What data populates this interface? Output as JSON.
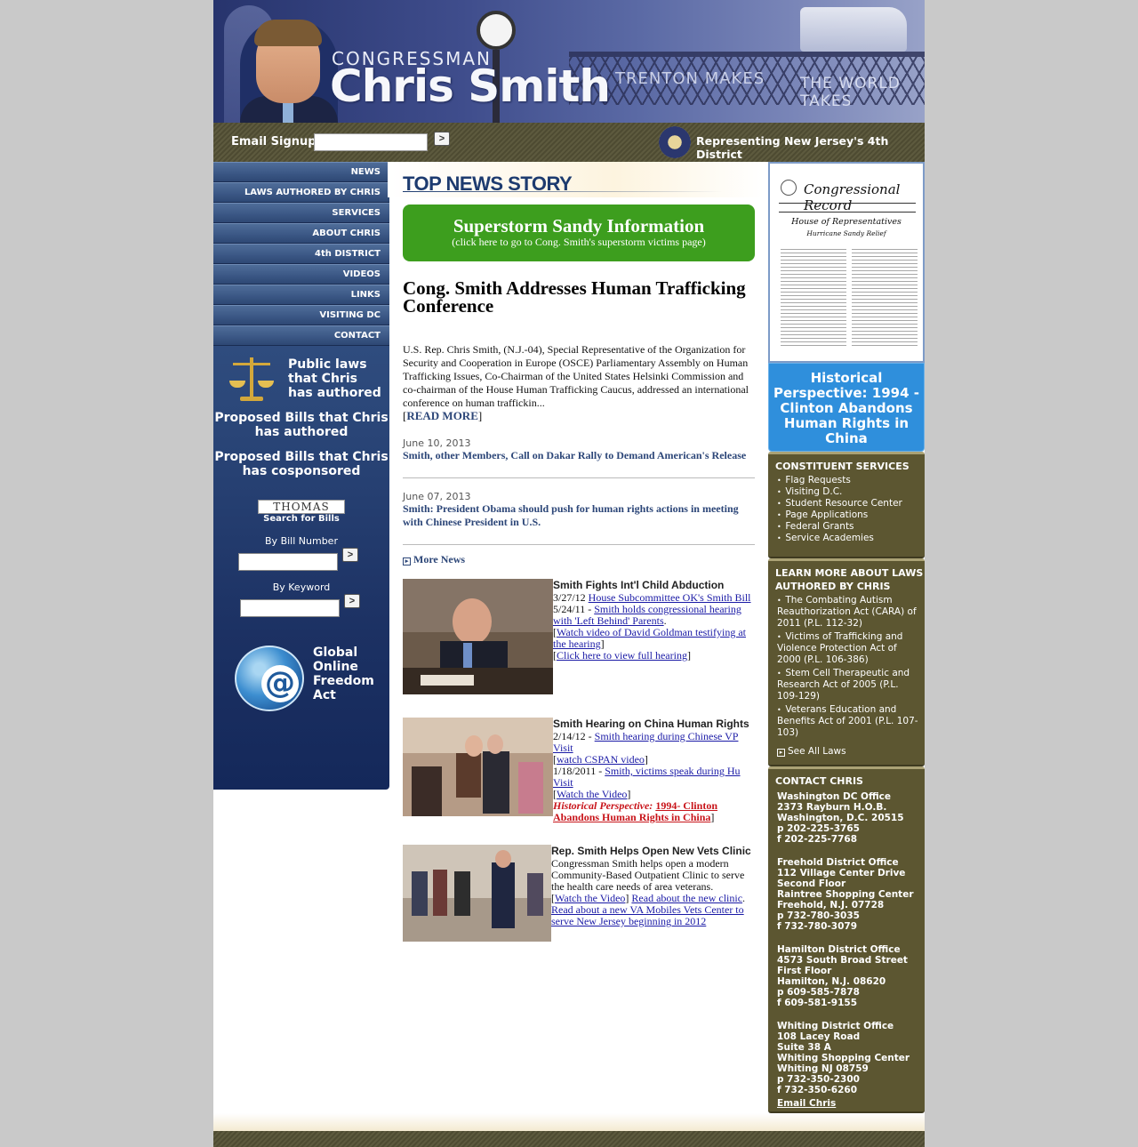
{
  "banner": {
    "congressman": "CONGRESSMAN",
    "name": "Chris Smith",
    "trenton": "TRENTON   MAKES",
    "world": "THE WORLD TAKES"
  },
  "signup": {
    "label": "Email Signup",
    "input_value": "",
    "go_label": ">",
    "representing": "Representing New Jersey's 4th District"
  },
  "nav": [
    "NEWS",
    "LAWS AUTHORED BY CHRIS",
    "SERVICES",
    "ABOUT CHRIS",
    "4th DISTRICT",
    "VIDEOS",
    "LINKS",
    "VISITING DC",
    "CONTACT"
  ],
  "left": {
    "public_laws": "Public laws that Chris has authored",
    "proposed_authored": "Proposed Bills that Chris has authored",
    "proposed_cosponsored": "Proposed Bills that Chris has cosponsored",
    "thomas": "THOMAS",
    "thomas_sub": "Search for Bills",
    "bill_number_label": "By Bill Number",
    "keyword_label": "By Keyword",
    "go_label": ">",
    "gofa": "Global Online Freedom Act"
  },
  "center": {
    "top_news": "TOP NEWS STORY",
    "sandy_title": "Superstorm Sandy Information",
    "sandy_sub": "(click here to go to Cong. Smith's superstorm victims page)",
    "headline": "Cong. Smith Addresses Human Trafficking Conference",
    "body": "U.S. Rep. Chris Smith, (N.J.-04), Special Representative of the Organization for Security and Cooperation in Europe (OSCE) Parliamentary Assembly on Human Trafficking Issues, Co-Chairman of the United States Helsinki Commission and co-chairman of the House Human Trafficking Caucus, addressed an international conference on human traffickin...",
    "read_more_open": "[",
    "read_more": "READ MORE",
    "read_more_close": "]",
    "news": [
      {
        "date": "June 10, 2013",
        "title": "Smith, other Members, Call on Dakar Rally to Demand American's Release"
      },
      {
        "date": "June 07, 2013",
        "title": "Smith: President Obama should push for human rights actions in meeting with Chinese President in U.S."
      }
    ],
    "more_news": "More News",
    "feature1": {
      "title": "Smith Fights Int'l Child Abduction",
      "d1": "3/27/12",
      "l1": "House Subcommittee OK's Smith Bill",
      "d2": "5/24/11 -",
      "l2": "Smith holds congressional hearing with 'Left Behind' Parents",
      "l3": "Watch video of David Goldman testifying at the hearing",
      "l4": "Click here to view full hearing"
    },
    "feature2": {
      "title": "Smith Hearing on China Human Rights",
      "d1": "2/14/12 -",
      "l1": "Smith hearing during Chinese VP Visit",
      "l2": "watch CSPAN video",
      "d3": "1/18/2011 -",
      "l3": "Smith, victims speak during Hu Visit",
      "l4": "Watch the Video",
      "hp": "Historical Perspective:",
      "l5": "1994- Clinton Abandons Human Rights in China"
    },
    "feature3": {
      "title": "Rep. Smith Helps Open New Vets Clinic",
      "text": "Congressman Smith helps open a modern Community-Based Outpatient Clinic to serve the health care needs of area veterans.",
      "l1": "Watch the Video",
      "l2": "Read about the new clinic",
      "l3": "Read about a new VA Mobiles Vets Center to serve New Jersey beginning in 2012"
    }
  },
  "right": {
    "record_title": "Congressional Record",
    "record_house": "House of Representatives",
    "record_sub": "Hurricane Sandy Relief",
    "historical": "Historical Perspective: 1994 - Clinton Abandons Human Rights in China",
    "constituent_title": "CONSTITUENT SERVICES",
    "constituent_items": [
      "Flag Requests",
      "Visiting D.C.",
      "Student Resource Center",
      "Page Applications",
      "Federal Grants",
      "Service Academies"
    ],
    "laws_title": "LEARN MORE ABOUT LAWS AUTHORED BY CHRIS",
    "laws_items": [
      "The Combating Autism Reauthorization Act (CARA) of 2011 (P.L. 112-32)",
      "Victims of Trafficking and Violence Protection Act of 2000 (P.L. 106-386)",
      "Stem Cell Therapeutic and Research Act of 2005 (P.L. 109-129)",
      "Veterans Education and Benefits Act of 2001 (P.L. 107-103)"
    ],
    "see_all": "See All Laws",
    "contact_title": "CONTACT CHRIS",
    "offices": [
      [
        "Washington DC Office",
        "2373 Rayburn H.O.B.",
        "Washington, D.C. 20515",
        "p 202-225-3765",
        "f 202-225-7768"
      ],
      [
        "Freehold District Office",
        "112 Village Center Drive",
        "Second Floor",
        "Raintree Shopping Center",
        "Freehold, N.J. 07728",
        "p 732-780-3035",
        "f 732-780-3079"
      ],
      [
        "Hamilton District Office",
        "4573 South Broad Street",
        "First Floor",
        "Hamilton, N.J. 08620",
        "p 609-585-7878",
        "f 609-581-9155"
      ],
      [
        "Whiting District Office",
        "108 Lacey Road",
        "Suite 38 A",
        "Whiting Shopping Center",
        "Whiting NJ 08759",
        "p 732-350-2300",
        "f 732-350-6260"
      ]
    ],
    "email": "Email Chris"
  }
}
